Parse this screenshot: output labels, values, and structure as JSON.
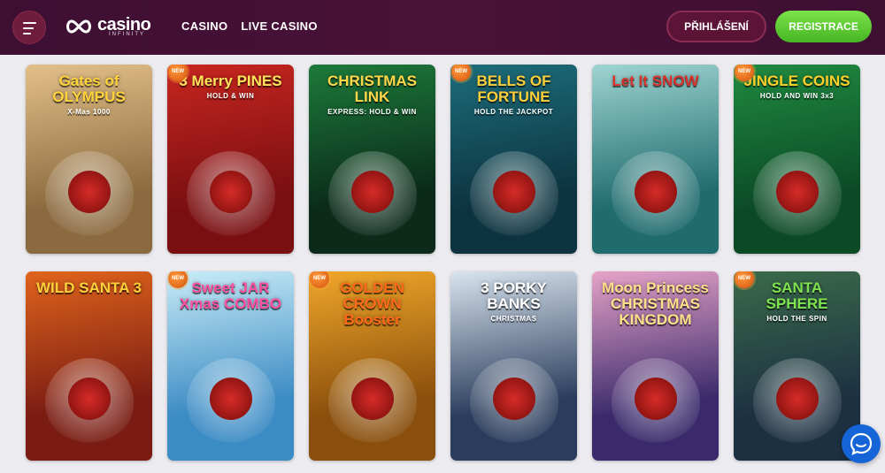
{
  "header": {
    "logo_text": "casino",
    "logo_sub": "INFINITY",
    "nav": [
      {
        "label": "CASINO"
      },
      {
        "label": "LIVE CASINO"
      }
    ],
    "login_label": "PŘIHLÁŠENÍ",
    "register_label": "REGISTRACE"
  },
  "badge_label": "NEW",
  "games": [
    {
      "title": "Gates of OLYMPUS",
      "sub": "X-Mas 1000",
      "new": false,
      "bg": "#8b6a3f",
      "bg2": "#e3c08a",
      "title_color": "#ffd33a"
    },
    {
      "title": "3 Merry PINES",
      "sub": "HOLD & WIN",
      "new": true,
      "bg": "#7a0f12",
      "bg2": "#c8261f",
      "title_color": "#ffe45c"
    },
    {
      "title": "CHRISTMAS LINK",
      "sub": "EXPRESS: HOLD & WIN",
      "new": false,
      "bg": "#0b2a1a",
      "bg2": "#1d7a3a",
      "title_color": "#ffd84a"
    },
    {
      "title": "BELLS OF FORTUNE",
      "sub": "HOLD THE JACKPOT",
      "new": true,
      "bg": "#0d3340",
      "bg2": "#1d6d7a",
      "title_color": "#ffcf3a"
    },
    {
      "title": "Let It SNOW",
      "sub": "",
      "new": false,
      "bg": "#1f6b6e",
      "bg2": "#9fd4d2",
      "title_color": "#d8322c"
    },
    {
      "title": "JINGLE COINS",
      "sub": "HOLD AND WIN 3x3",
      "new": true,
      "bg": "#0c4a26",
      "bg2": "#1f8a40",
      "title_color": "#ffcf2a"
    },
    {
      "title": "WILD SANTA 3",
      "sub": "",
      "new": false,
      "bg": "#7a1c13",
      "bg2": "#e0641c",
      "title_color": "#ffd13a"
    },
    {
      "title": "Sweet JAR Xmas COMBO",
      "sub": "",
      "new": true,
      "bg": "#3b8bc4",
      "bg2": "#c9ecf7",
      "title_color": "#ff4fa0"
    },
    {
      "title": "GOLDEN CROWN Booster",
      "sub": "",
      "new": true,
      "bg": "#8a4f0c",
      "bg2": "#f1a72a",
      "title_color": "#ff6a1a"
    },
    {
      "title": "3 PORKY BANKS",
      "sub": "CHRISTMAS",
      "new": false,
      "bg": "#2a3d5c",
      "bg2": "#d9e4ef",
      "title_color": "#ffffff"
    },
    {
      "title": "Moon Princess CHRISTMAS KINGDOM",
      "sub": "",
      "new": false,
      "bg": "#3a2a6b",
      "bg2": "#e6a3c8",
      "title_color": "#ffe08a"
    },
    {
      "title": "SANTA SPHERE",
      "sub": "HOLD THE SPIN",
      "new": true,
      "bg": "#1c3042",
      "bg2": "#3b6a4a",
      "title_color": "#7de24e"
    }
  ]
}
